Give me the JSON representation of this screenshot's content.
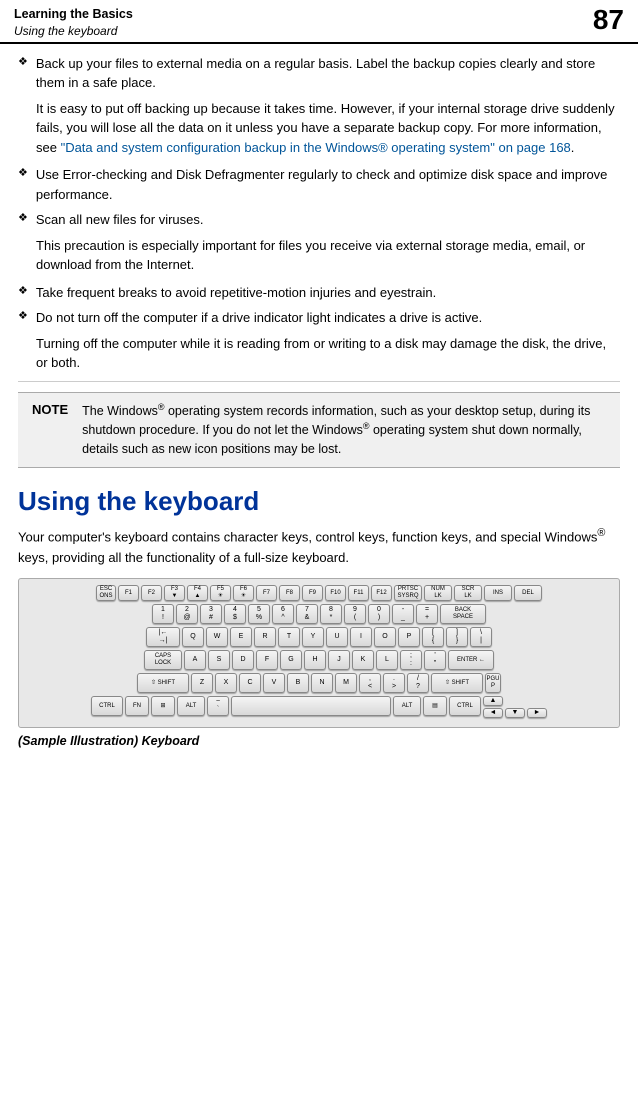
{
  "header": {
    "section": "Learning the Basics",
    "sub": "Using the keyboard",
    "page_number": "87"
  },
  "bullets": [
    {
      "id": "b1",
      "text": "Back up your files to external media on a regular basis. Label the backup copies clearly and store them in a safe place.",
      "subpara": "It is easy to put off backing up because it takes time. However, if your internal storage drive suddenly fails, you will lose all the data on it unless you have a separate backup copy. For more information, see “Data and system configuration backup in the Windows® operating system” on page 168."
    },
    {
      "id": "b2",
      "text": "Use Error-checking and Disk Defragmenter regularly to check and optimize disk space and improve performance.",
      "subpara": ""
    },
    {
      "id": "b3",
      "text": "Scan all new files for viruses.",
      "subpara": "This precaution is especially important for files you receive via external storage media, email, or download from the Internet."
    },
    {
      "id": "b4",
      "text": "Take frequent breaks to avoid repetitive-motion injuries and eyestrain.",
      "subpara": ""
    },
    {
      "id": "b5",
      "text": "Do not turn off the computer if a drive indicator light indicates a drive is active.",
      "subpara": "Turning off the computer while it is reading from or writing to a disk may damage the disk, the drive, or both."
    }
  ],
  "note": {
    "label": "NOTE",
    "text": "The Windows® operating system records information, such as your desktop setup, during its shutdown procedure. If you do not let the Windows® operating system shut down normally, details such as new icon positions may be lost."
  },
  "section_title": "Using the keyboard",
  "section_intro": "Your computer’s keyboard contains character keys, control keys, function keys, and special Windows® keys, providing all the functionality of a full-size keyboard.",
  "keyboard_caption_prefix": "(Sample Illustration)",
  "keyboard_caption_suffix": " Keyboard",
  "link_text": "Data and system configuration backup in the Windows® operating system” on page 168"
}
